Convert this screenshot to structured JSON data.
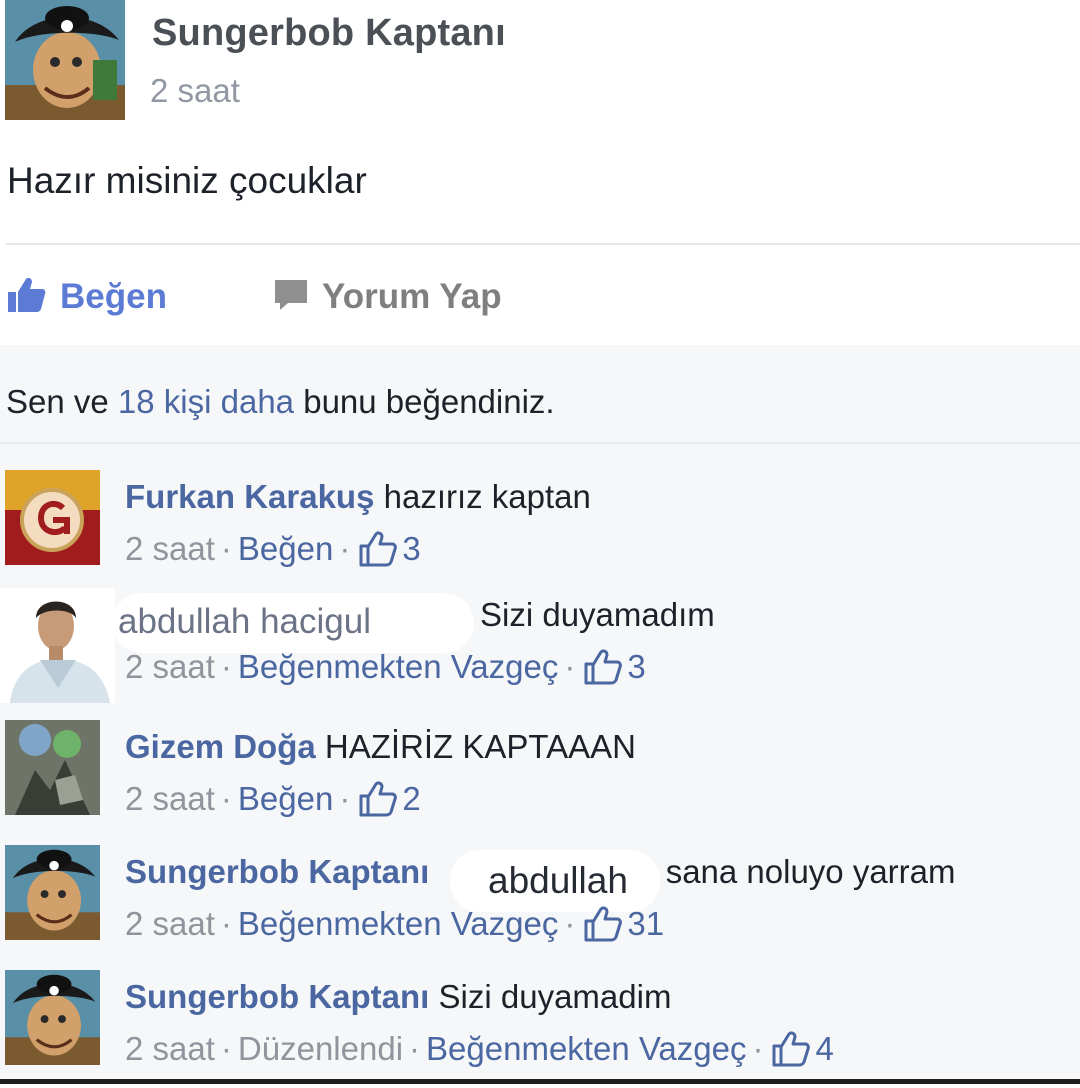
{
  "post": {
    "author": "Sungerbob Kaptanı",
    "time": "2 saat",
    "text": "Hazır misiniz çocuklar"
  },
  "actions": {
    "like_label": "Beğen",
    "comment_label": "Yorum Yap"
  },
  "likes_summary": {
    "prefix": "Sen ve ",
    "count_link": "18 kişi daha",
    "suffix": " bunu beğendiniz."
  },
  "comments": [
    {
      "author": "Furkan Karakuş",
      "text": "hazırız kaptan",
      "time": "2 saat",
      "action": "Beğen",
      "likes": "3"
    },
    {
      "author": "abdullah hacigul",
      "text": "Sizi duyamadım",
      "time": "2 saat",
      "action": "Beğenmekten Vazgeç",
      "likes": "3"
    },
    {
      "author": "Gizem Doğa",
      "text": "HAZİRİZ KAPTAAAN",
      "time": "2 saat",
      "action": "Beğen",
      "likes": "2"
    },
    {
      "author": "Sungerbob Kaptanı",
      "mention": "abdullah",
      "text": "sana noluyo yarram",
      "time": "2 saat",
      "action": "Beğenmekten Vazgeç",
      "likes": "31"
    },
    {
      "author": "Sungerbob Kaptanı",
      "text": "Sizi duyamadim",
      "time": "2 saat",
      "edited": "Düzenlendi",
      "action": "Beğenmekten Vazgeç",
      "likes": "4"
    }
  ],
  "icons": {
    "like": "thumbs-up-icon",
    "comment": "speech-bubble-icon",
    "reaction": "thumbs-up-outline-icon"
  },
  "colors": {
    "link": "#4b67a1",
    "like_blue": "#5b7bd5",
    "meta_gray": "#90949c",
    "feedback_bg": "#f6f7f9"
  }
}
